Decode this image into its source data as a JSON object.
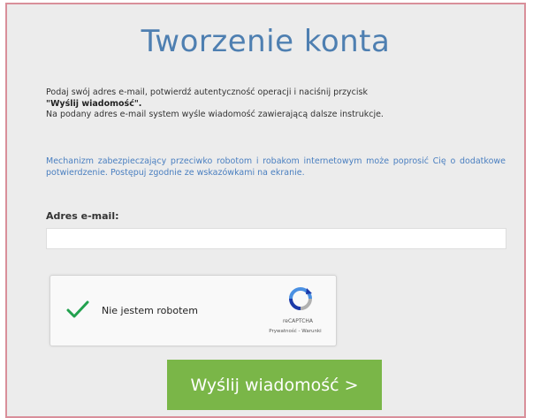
{
  "form": {
    "title": "Tworzenie konta",
    "intro_line1": "Podaj swój adres e-mail, potwierdź autentyczność operacji i naciśnij przycisk",
    "intro_bold": "\"Wyślij wiadomość\".",
    "intro_line2": "Na podany adres e-mail system wyśle wiadomość zawierającą dalsze instrukcje.",
    "notice": "Mechanizm zabezpieczający przeciwko robotom i robakom internetowym może poprosić Cię o dodatkowe potwierdzenie. Postępuj zgodnie ze wskazówkami na ekranie.",
    "email_label": "Adres e-mail:",
    "email_value": "",
    "submit_label": "Wyślij wiadomość >"
  },
  "captcha": {
    "label": "Nie jestem robotem",
    "brand": "reCAPTCHA",
    "links": "Prywatność - Warunki",
    "checked": true,
    "check_icon": "checkmark-icon",
    "logo_icon": "recaptcha-logo-icon"
  },
  "colors": {
    "title": "#4e7fb1",
    "notice": "#4a7fc0",
    "panel_border": "#d98f9a",
    "button": "#7ab648",
    "check": "#22a14e"
  }
}
